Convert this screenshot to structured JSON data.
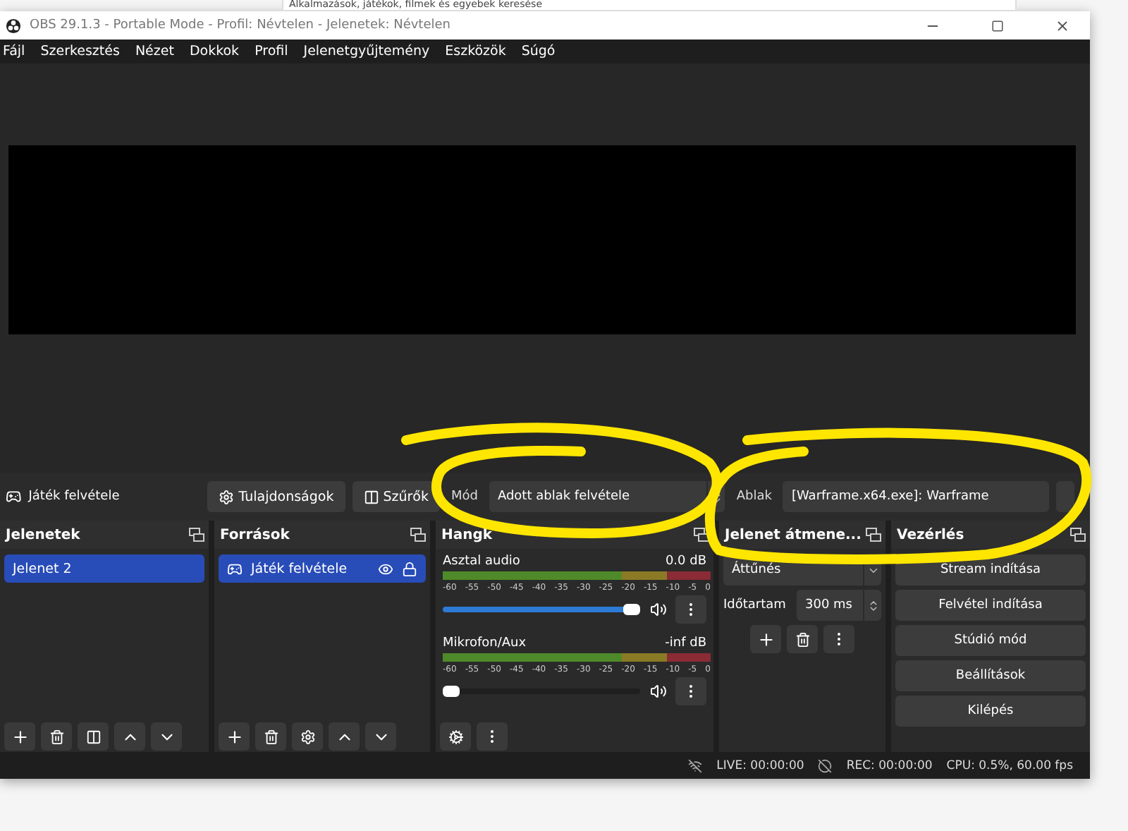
{
  "background_search": {
    "placeholder": "Alkalmazások, játékok, filmek és egyebek keresése"
  },
  "window": {
    "title": "OBS 29.1.3 - Portable Mode - Profil: Névtelen - Jelenetek: Névtelen"
  },
  "menu": [
    "Fájl",
    "Szerkesztés",
    "Nézet",
    "Dokkok",
    "Profil",
    "Jelenetgyűjtemény",
    "Eszközök",
    "Súgó"
  ],
  "source_toolbar": {
    "source_name": "Játék felvétele",
    "buttons": [
      "Tulajdonságok",
      "Szűrők"
    ],
    "mode_label": "Mód",
    "mode_value": "Adott ablak felvétele",
    "window_label": "Ablak",
    "window_value": "[Warframe.x64.exe]: Warframe"
  },
  "scenes": {
    "title": "Jelenetek",
    "items": [
      {
        "label": "Jelenet 2",
        "selected": true
      }
    ]
  },
  "sources": {
    "title": "Források",
    "items": [
      {
        "label": "Játék felvétele",
        "selected": true,
        "visible": true,
        "locked": true
      }
    ]
  },
  "mixer": {
    "title": "Hangk",
    "channels": [
      {
        "name": "Asztal audio",
        "reading": "0.0 dB",
        "level": 1,
        "scale": [
          "-60",
          "-55",
          "-50",
          "-45",
          "-40",
          "-35",
          "-30",
          "-25",
          "-20",
          "-15",
          "-10",
          "-5",
          "0"
        ]
      },
      {
        "name": "Mikrofon/Aux",
        "reading": "-inf dB",
        "level": 0,
        "scale": [
          "-60",
          "-55",
          "-50",
          "-45",
          "-40",
          "-35",
          "-30",
          "-25",
          "-20",
          "-15",
          "-10",
          "-5",
          "0"
        ]
      }
    ]
  },
  "transitions": {
    "title": "Jelenet átmene...",
    "transition": "Áttűnés",
    "duration_label": "Időtartam",
    "duration": "300 ms"
  },
  "controls": {
    "title": "Vezérlés",
    "buttons": [
      "Stream indítása",
      "Felvétel indítása",
      "Stúdió mód",
      "Beállítások",
      "Kilépés"
    ]
  },
  "status_bar": {
    "live": "LIVE: 00:00:00",
    "rec": "REC: 00:00:00",
    "cpu": "CPU: 0.5%, 60.00 fps"
  }
}
